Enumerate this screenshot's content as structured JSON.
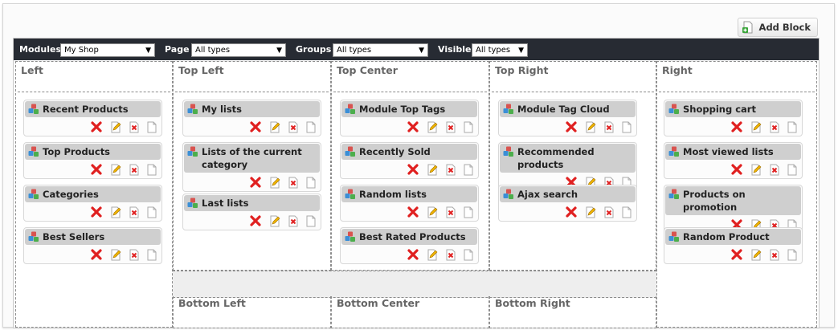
{
  "header": {
    "add_block_label": "Add Block"
  },
  "toolbar": {
    "modules_label": "Modules",
    "modules_value": "My Shop",
    "page_label": "Page",
    "page_value": "All types",
    "groups_label": "Groups",
    "groups_value": "All types",
    "visible_label": "Visible",
    "visible_value": "All types"
  },
  "columns": {
    "left": {
      "title": "Left",
      "blocks": [
        "Recent Products",
        "Top Products",
        "Categories",
        "Best Sellers"
      ]
    },
    "top_left": {
      "title": "Top Left",
      "blocks": [
        "My lists",
        "Lists of the current category",
        "Last lists"
      ]
    },
    "top_center": {
      "title": "Top Center",
      "blocks": [
        "Module Top Tags",
        "Recently Sold",
        "Random lists",
        "Best Rated Products"
      ]
    },
    "top_right": {
      "title": "Top Right",
      "blocks": [
        "Module Tag Cloud",
        "Recommended products",
        "Ajax search"
      ]
    },
    "right": {
      "title": "Right",
      "blocks": [
        "Shopping cart",
        "Most viewed lists",
        "Products on promotion",
        "Random Product"
      ]
    },
    "bottom_left": {
      "title": "Bottom Left"
    },
    "bottom_center": {
      "title": "Bottom Center"
    },
    "bottom_right": {
      "title": "Bottom Right"
    }
  },
  "icons": {
    "module": "module-cubes-icon",
    "delete": "delete-x-icon",
    "edit": "edit-pencil-icon",
    "remove": "remove-small-icon",
    "copy": "copy-page-icon"
  },
  "colors": {
    "toolbar_bg": "#272b33",
    "block_header_bg": "#cfcfcf",
    "delete_red": "#e02020"
  }
}
